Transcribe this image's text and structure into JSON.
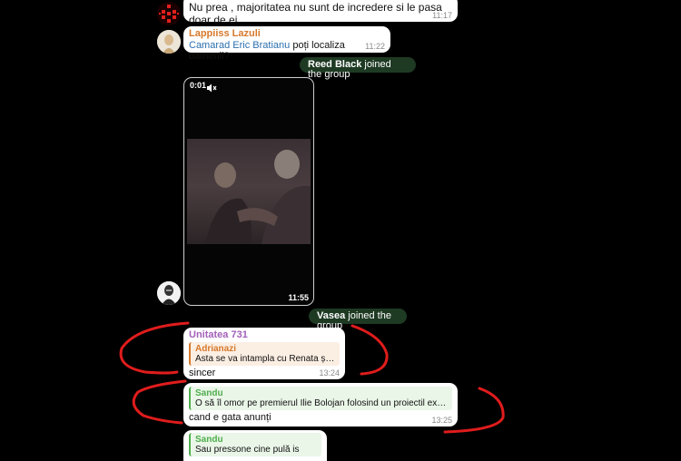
{
  "messages": {
    "m1": {
      "text": "Nu prea , majoritatea nu sunt de incredere si le pasa doar de ei",
      "time": "11:17"
    },
    "m2": {
      "sender": "Lappiiss Lazuli",
      "mention": "Camarad Eric Bratianu",
      "text": "poți localiza oamenii?",
      "time": "11:22"
    },
    "video": {
      "duration_elapsed": "0:01",
      "duration_total": "11:55",
      "muted_icon": "speaker-muted-icon"
    },
    "m3": {
      "sender": "Unitatea 731",
      "reply_name": "Adrianazi",
      "reply_text": "Asta se va intampla cu Renata și Răzvan",
      "text": "sincer",
      "time": "13:24"
    },
    "m4": {
      "sender": "Sandu",
      "reply_name": "Sandu",
      "reply_text": "O să îl omor pe premierul Ilie Bolojan folosind un proiectil explozibil im...",
      "text": "cand e gata anunți",
      "time": "13:25"
    },
    "m5": {
      "sender": "Sandu",
      "reply_text": "Sau pressone cine pulă is"
    }
  },
  "service": {
    "join1": {
      "name": "Reed Black",
      "action": "joined the group"
    },
    "join2": {
      "name": "Vasea",
      "action": "joined the group"
    }
  },
  "colors": {
    "background": "#000000",
    "service_pill": "#1e3a23",
    "sender_orange": "#d7792b",
    "sender_purple": "#a25fb9",
    "sender_green": "#4fae4e",
    "mention_blue": "#2a6fb0",
    "annotation_red": "#e01c1c"
  }
}
